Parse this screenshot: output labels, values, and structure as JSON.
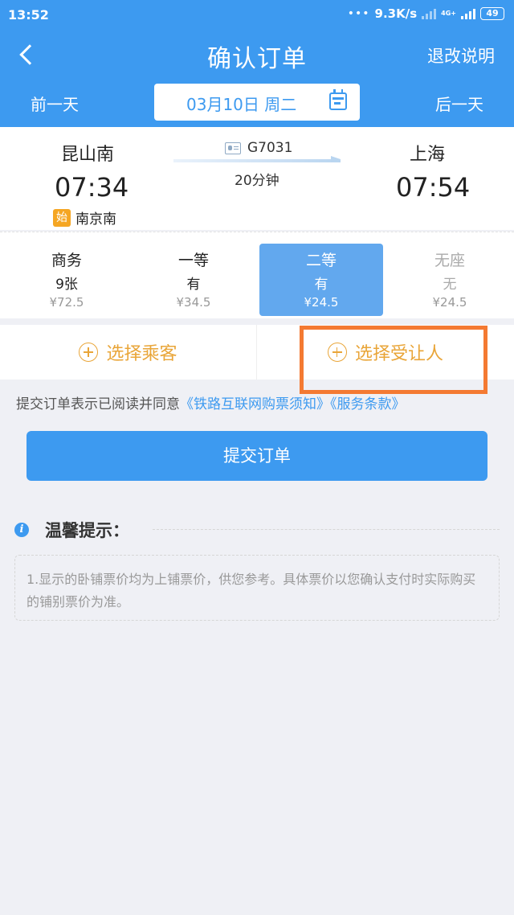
{
  "status_bar": {
    "time": "13:52",
    "speed": "9.3K/s",
    "network": "4G+",
    "battery": "49"
  },
  "header": {
    "title": "确认订单",
    "refund_link": "退改说明",
    "prev_day": "前一天",
    "next_day": "后一天",
    "date": "03月10日 周二"
  },
  "train": {
    "from": "昆山南",
    "to": "上海",
    "departure": "07:34",
    "arrival": "07:54",
    "origin_badge": "始",
    "origin_station": "南京南",
    "number": "G7031",
    "duration": "20分钟"
  },
  "seats": [
    {
      "name": "商务",
      "availability": "9张",
      "price": "¥72.5"
    },
    {
      "name": "一等",
      "availability": "有",
      "price": "¥34.5"
    },
    {
      "name": "二等",
      "availability": "有",
      "price": "¥24.5"
    },
    {
      "name": "无座",
      "availability": "无",
      "price": "¥24.5"
    }
  ],
  "actions": {
    "select_passenger": "选择乘客",
    "select_beneficiary": "选择受让人"
  },
  "agreement": {
    "prefix": "提交订单表示已阅读并同意",
    "link1": "《铁路互联网购票须知》",
    "link2": "《服务条款》"
  },
  "submit_label": "提交订单",
  "tips": {
    "title": "温馨提示：",
    "text": "1.显示的卧铺票价均为上铺票价，供您参考。具体票价以您确认支付时实际购买的铺别票价为准。"
  },
  "colors": {
    "primary": "#3d9af0",
    "accent": "#e9a538",
    "highlight": "#f47a32"
  }
}
